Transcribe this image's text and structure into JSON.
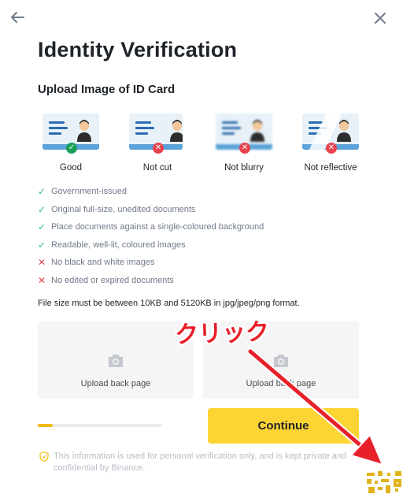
{
  "header": {
    "back_icon": "arrow-left-icon",
    "close_icon": "close-icon",
    "title": "Identity Verification"
  },
  "section": {
    "title": "Upload Image of ID Card"
  },
  "examples": [
    {
      "label": "Good",
      "status": "good"
    },
    {
      "label": "Not cut",
      "status": "bad"
    },
    {
      "label": "Not blurry",
      "status": "bad"
    },
    {
      "label": "Not reflective",
      "status": "bad"
    }
  ],
  "rules": [
    {
      "text": "Government-issued",
      "ok": true
    },
    {
      "text": "Original full-size, unedited documents",
      "ok": true
    },
    {
      "text": "Place documents against a single-coloured background",
      "ok": true
    },
    {
      "text": "Readable, well-lit, coloured images",
      "ok": true
    },
    {
      "text": "No black and white images",
      "ok": false
    },
    {
      "text": "No edited or expired documents",
      "ok": false
    }
  ],
  "file_size_text": "File size must be between 10KB and 5120KB in jpg/jpeg/png format.",
  "uploads": [
    {
      "label": "Upload back page",
      "icon": "camera-icon"
    },
    {
      "label": "Upload back page",
      "icon": "camera-icon"
    }
  ],
  "progress": {
    "fraction": 0.12
  },
  "continue_label": "Continue",
  "privacy_note": "This information is used for personal verification only, and is kept private and confidential by Binance.",
  "annotation": {
    "text": "クリック",
    "color": "#e8202a"
  },
  "colors": {
    "accent": "#fcd535",
    "success": "#2ebd85",
    "error": "#e8424c",
    "text_primary": "#1e2329",
    "text_secondary": "#707a8a"
  }
}
